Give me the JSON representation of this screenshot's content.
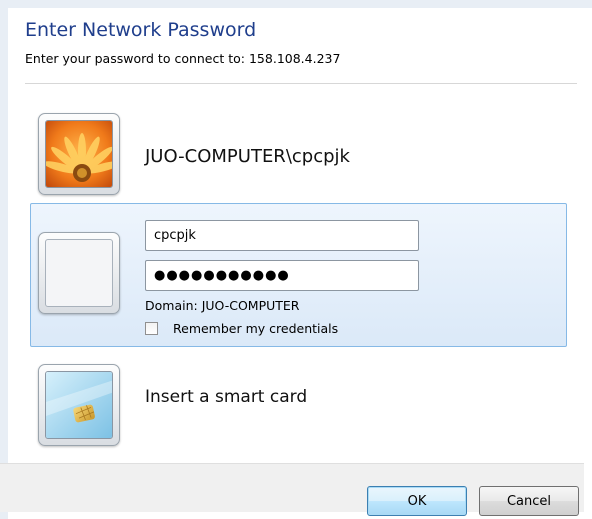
{
  "dialog": {
    "title": "Enter Network Password",
    "subtitle": "Enter your password to connect to: 158.108.4.237"
  },
  "accounts": {
    "existing_user": "JUO-COMPUTER\\cpcpjk",
    "selected": {
      "username_value": "cpcpjk",
      "password_value": "●●●●●●●●●●●",
      "domain_label": "Domain: JUO-COMPUTER",
      "remember_label": "Remember my credentials",
      "remember_checked": false
    },
    "smartcard_label": "Insert a smart card"
  },
  "buttons": {
    "ok_label": "OK",
    "cancel_label": "Cancel"
  },
  "icons": {
    "flower": "flower-avatar-icon",
    "blank_user": "blank-user-icon",
    "smartcard": "smart-card-icon"
  },
  "colors": {
    "title": "#1f3e8c",
    "selection_border": "#86b9e6",
    "selection_bg": "#dbe9f8"
  }
}
